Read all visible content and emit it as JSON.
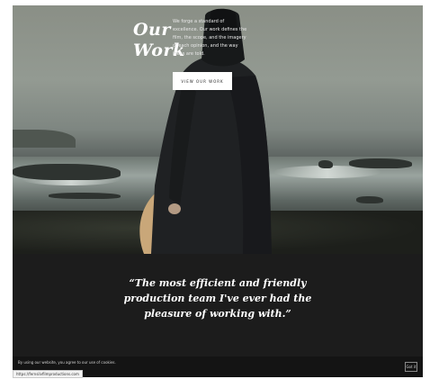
{
  "hero": {
    "title_line1": "Our",
    "title_line2": "Work",
    "blurb": "We forge a standard of excellence. Our work defines the film, the scope, and the imagery of each opinion, and the way ideas are told.",
    "button_label": "VIEW OUR WORK"
  },
  "testimonial": {
    "quote": "“The most efficient and friendly production team I've ever had the pleasure of working with.”"
  },
  "cookie_bar": {
    "text": "By using our website, you agree to our use of cookies.",
    "button_label": "Got it"
  },
  "status_bar": {
    "url": "https://fernsilvfilmproductions.com"
  },
  "colors": {
    "background": "#1c1c1c",
    "text": "#ffffff",
    "button_bg": "#ffffff"
  }
}
